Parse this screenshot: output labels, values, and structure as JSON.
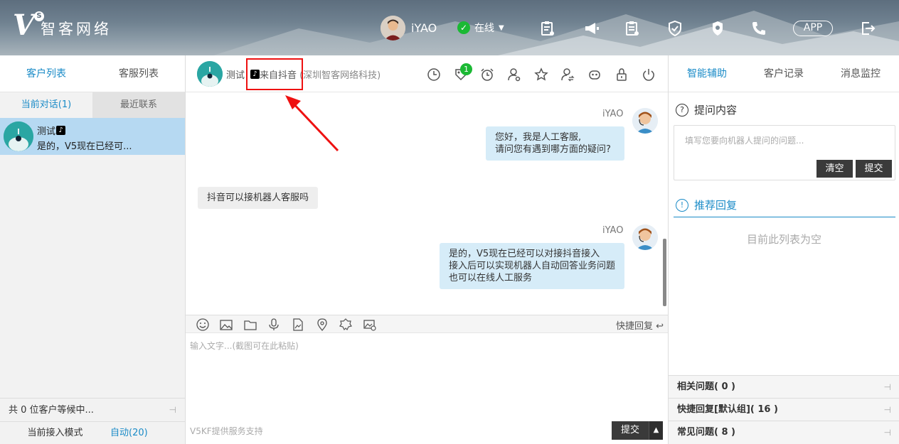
{
  "brand": {
    "logo_letter": "V",
    "logo_badge": "S",
    "name": "智客网络"
  },
  "topbar": {
    "user_name": "iYAO",
    "status": "在线",
    "app_label": "APP",
    "icons": [
      "clipboard-icon",
      "megaphone-icon",
      "notes-icon",
      "shield-icon",
      "badge-icon",
      "phone-icon",
      "logout-icon"
    ]
  },
  "left": {
    "tabs": [
      "客户列表",
      "客服列表"
    ],
    "subtabs": [
      "当前对话(1)",
      "最近联系"
    ],
    "conversation": {
      "name": "测试",
      "tiktok_icon": "♪",
      "preview": "是的，V5现在已经可..."
    },
    "waiting": "共 0 位客户等候中...",
    "pin": "⊣",
    "mode_label": "当前接入模式",
    "mode_value": "自动(20)"
  },
  "chat": {
    "header_name": "测试",
    "source": "来自抖音",
    "company": "(深圳智客网络科技)",
    "badge_count": "1",
    "messages": [
      {
        "agent": "iYAO",
        "lines": [
          "您好，我是人工客服,",
          "请问您有遇到哪方面的疑问?"
        ]
      },
      {
        "customer": "抖音可以接机器人客服吗"
      },
      {
        "agent": "iYAO",
        "lines": [
          "是的，V5现在已经可以对接抖音接入",
          "接入后可以实现机器人自动回答业务问题",
          "也可以在线人工服务"
        ]
      }
    ],
    "quick_reply": "快捷回复",
    "input_placeholder": "输入文字...(截图可在此粘贴)",
    "footer": "V5KF提供服务支持",
    "submit": "提交",
    "submit_caret": "▲"
  },
  "right": {
    "tabs": [
      "智能辅助",
      "客户记录",
      "消息监控"
    ],
    "question_title": "提问内容",
    "question_icon": "?",
    "question_placeholder": "填写您要向机器人提问的问题...",
    "clear": "清空",
    "submit": "提交",
    "recommend_title": "推荐回复",
    "recommend_icon": "!",
    "empty": "目前此列表为空",
    "sections": [
      "相关问题( 0 )",
      "快捷回复[默认组]( 16 )",
      "常见问题( 8 )"
    ]
  },
  "colors": {
    "accent": "#1a8bc7",
    "online": "#1bb934",
    "agent_bubble": "#d6ecf8",
    "selected": "#b6d9f2",
    "annotation": "#e11111"
  }
}
